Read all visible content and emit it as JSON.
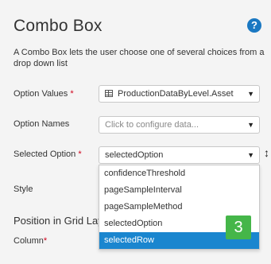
{
  "header": {
    "title": "Combo Box",
    "help_icon": "?"
  },
  "description": "A Combo Box lets the user choose one of several choices from a drop down list",
  "fields": {
    "option_values": {
      "label": "Option Values",
      "required_mark": "*",
      "value": "ProductionDataByLevel.Asset"
    },
    "option_names": {
      "label": "Option Names",
      "placeholder": "Click to configure data..."
    },
    "selected_option": {
      "label": "Selected Option",
      "required_mark": "*",
      "value": "selectedOption"
    },
    "style": {
      "label": "Style"
    }
  },
  "section": {
    "title": "Position in Grid Lay"
  },
  "column": {
    "label": "Column",
    "required_mark": "*"
  },
  "dropdown": {
    "items": [
      {
        "label": "confidenceThreshold"
      },
      {
        "label": "pageSampleInterval"
      },
      {
        "label": "pageSampleMethod"
      },
      {
        "label": "selectedOption"
      },
      {
        "label": "selectedRow"
      }
    ],
    "selected_index": 4
  },
  "badge": {
    "value": "3",
    "color": "#45b649"
  },
  "colors": {
    "accent": "#1a86cf",
    "required": "#d0021b"
  },
  "icons": {
    "arrow": "▼",
    "resize": "↕"
  }
}
